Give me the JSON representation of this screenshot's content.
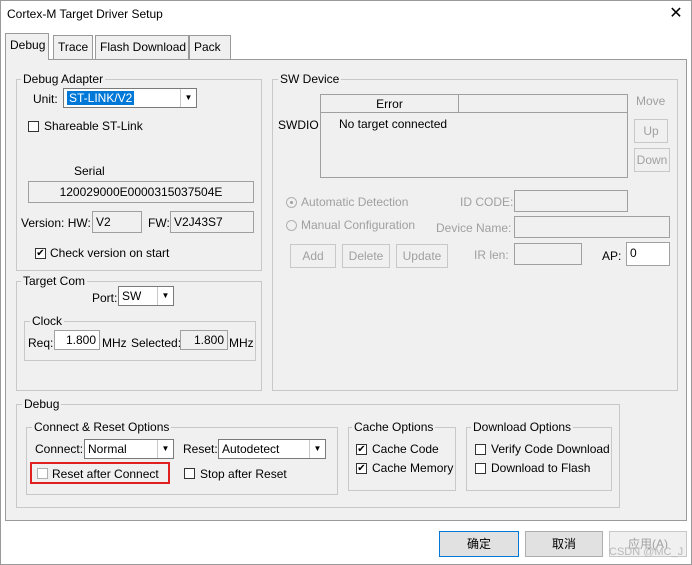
{
  "window": {
    "title": "Cortex-M Target Driver Setup",
    "close_glyph": "✕"
  },
  "tabs": [
    {
      "label": "Debug",
      "active": true
    },
    {
      "label": "Trace"
    },
    {
      "label": "Flash Download"
    },
    {
      "label": "Pack"
    }
  ],
  "debug_adapter": {
    "legend": "Debug Adapter",
    "unit_label": "Unit:",
    "unit_value": "ST-LINK/V2",
    "shareable_label": "Shareable ST-Link",
    "shareable_checked": false,
    "serial_label": "Serial",
    "serial_value": "120029000E0000315037504E",
    "version_hw_label": "Version: HW:",
    "version_hw_value": "V2",
    "fw_label": "FW:",
    "fw_value": "V2J43S7",
    "check_version_label": "Check version on start",
    "check_version_checked": true
  },
  "target_com": {
    "legend": "Target Com",
    "port_label": "Port:",
    "port_value": "SW",
    "clock_legend": "Clock",
    "req_label": "Req:",
    "req_value": "1.800",
    "req_unit": "MHz",
    "selected_label": "Selected:",
    "selected_value": "1.800",
    "selected_unit": "MHz"
  },
  "sw_device": {
    "legend": "SW Device",
    "swdio_label": "SWDIO",
    "error_header": "Error",
    "error_value": "No target connected",
    "move_label": "Move",
    "up_label": "Up",
    "down_label": "Down",
    "auto_detect_label": "Automatic Detection",
    "manual_config_label": "Manual Configuration",
    "id_code_label": "ID CODE:",
    "device_name_label": "Device Name:",
    "ir_len_label": "IR len:",
    "ap_label": "AP:",
    "ap_value": "0",
    "add_label": "Add",
    "delete_label": "Delete",
    "update_label": "Update"
  },
  "debug": {
    "legend": "Debug",
    "connect_reset_legend": "Connect & Reset Options",
    "connect_label": "Connect:",
    "connect_value": "Normal",
    "reset_label": "Reset:",
    "reset_value": "Autodetect",
    "reset_after_connect_label": "Reset after Connect",
    "reset_after_connect_checked": false,
    "stop_after_reset_label": "Stop after Reset",
    "stop_after_reset_checked": false,
    "cache_legend": "Cache Options",
    "cache_code_label": "Cache Code",
    "cache_code_checked": true,
    "cache_memory_label": "Cache Memory",
    "cache_memory_checked": true,
    "download_legend": "Download Options",
    "verify_label": "Verify Code Download",
    "verify_checked": false,
    "download_flash_label": "Download to Flash",
    "download_flash_checked": false
  },
  "footer": {
    "ok_label": "确定",
    "cancel_label": "取消",
    "apply_label": "应用(A)",
    "watermark": "CSDN @MC_J"
  },
  "colors": {
    "highlight_box": "#e02020",
    "selection": "#0078d7"
  }
}
